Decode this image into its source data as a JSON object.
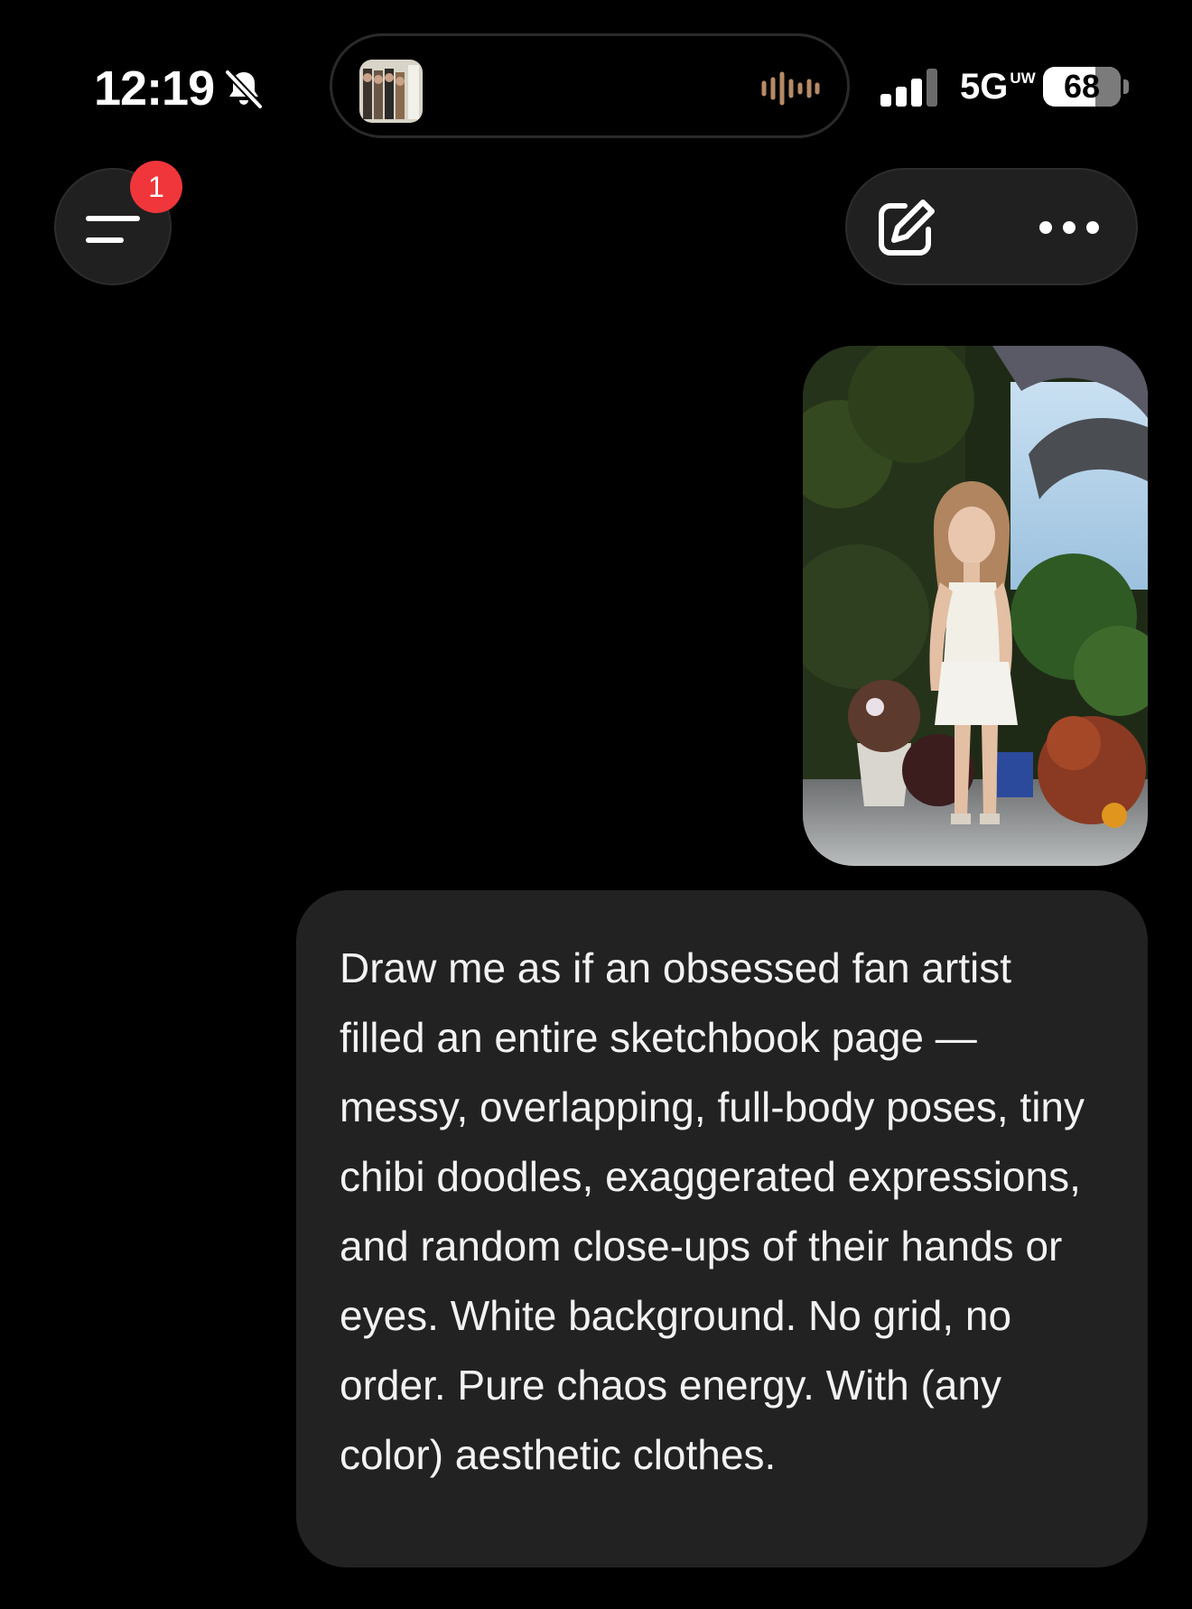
{
  "status_bar": {
    "time": "12:19",
    "network": "5G",
    "network_badge": "UW",
    "battery": "68",
    "mute_icon": "bell-slash-icon",
    "signal_icon": "cellular-signal-icon",
    "live_activity_icon": "audio-waveform-icon"
  },
  "header": {
    "menu_icon": "sidebar-menu-icon",
    "notification_count": "1",
    "new_chat_icon": "compose-icon",
    "more_icon": "ellipsis-icon"
  },
  "conversation": {
    "messages": [
      {
        "role": "user",
        "attachment": {
          "type": "image"
        },
        "text": "Draw me as if an obsessed fan artist filled an entire sketchbook page — messy, overlapping, full-body poses, tiny chibi doodles, exaggerated expressions, and random close-ups of their hands or eyes. White background. No grid, no order. Pure chaos energy. With (any color) aesthetic clothes."
      }
    ]
  },
  "colors": {
    "background": "#000000",
    "bubble": "#222222",
    "badge": "#f0363a",
    "control": "#202020"
  }
}
